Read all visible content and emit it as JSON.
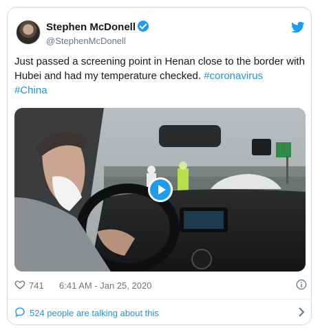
{
  "author": {
    "name": "Stephen McDonell",
    "handle": "@StephenMcDonell"
  },
  "tweet": {
    "text_plain": "Just passed a screening point in Henan close to the border with Hubei and had my temperature checked. ",
    "hashtags": [
      "#coronavirus",
      "#China"
    ]
  },
  "media": {
    "type": "video",
    "play_icon": "play-icon"
  },
  "meta": {
    "likes": "741",
    "timestamp": "6:41 AM - Jan 25, 2020"
  },
  "conversation": {
    "label": "524 people are talking about this"
  },
  "colors": {
    "accent": "#1b95e0",
    "text": "#14171a",
    "muted": "#657786",
    "border": "#cfd9de"
  }
}
